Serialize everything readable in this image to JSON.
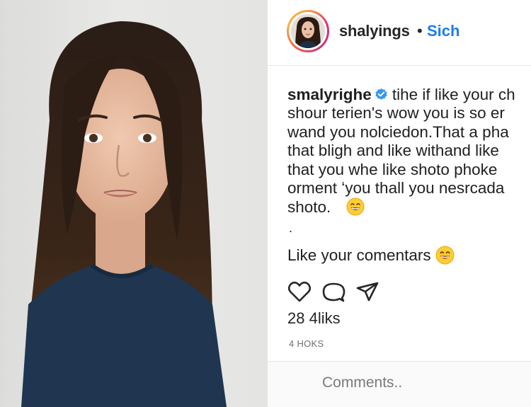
{
  "post": {
    "photo_description": "portrait-photo",
    "header": {
      "username": "shalyings",
      "separator": "•",
      "follow_label": "Sich"
    },
    "caption": {
      "author": "smalyrighe",
      "lines": [
        "tihe if like your ch",
        "shour terien's wow you is so er",
        "wand you nolciedon.That a pha",
        "that bligh and like withand like",
        "that you whe like shoto phoke",
        "orment ʻyou thall you nesrcada",
        "shoto."
      ]
    },
    "bullet": ".",
    "comment": {
      "text": "Like your comentars"
    },
    "likes": "28 4liks",
    "timestamp": "4 HOKS",
    "comment_input": {
      "placeholder": "Comments.."
    },
    "colors": {
      "accent": "#1a7df0",
      "verified": "#3897f0",
      "text": "#262626",
      "muted": "#6f6f6f"
    },
    "icons": [
      "heart-icon",
      "comment-icon",
      "share-icon",
      "verified-icon",
      "smile-emoji-icon"
    ]
  }
}
